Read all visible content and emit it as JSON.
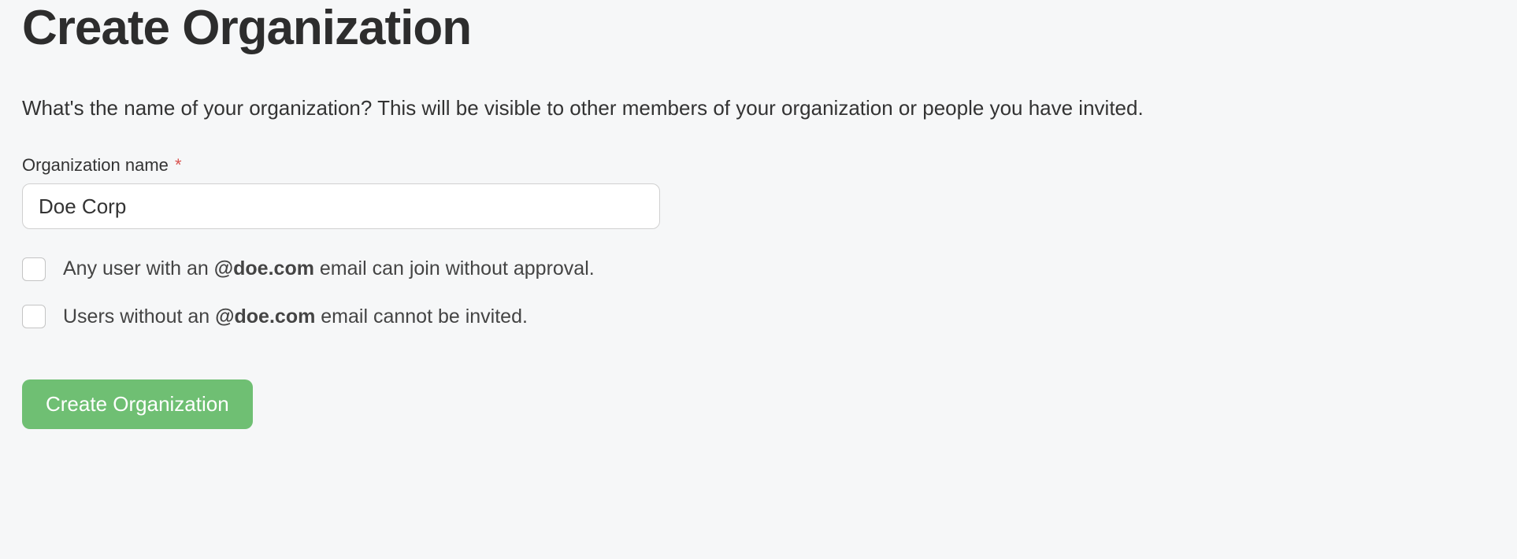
{
  "header": {
    "title": "Create Organization"
  },
  "description": "What's the name of your organization? This will be visible to other members of your organization or people you have invited.",
  "form": {
    "org_name_label": "Organization name",
    "required_mark": "*",
    "org_name_value": "Doe Corp",
    "checkbox1": {
      "prefix": "Any user with an ",
      "domain": "@doe.com",
      "suffix": " email can join without approval."
    },
    "checkbox2": {
      "prefix": "Users without an ",
      "domain": "@doe.com",
      "suffix": " email cannot be invited."
    },
    "submit_label": "Create Organization"
  }
}
